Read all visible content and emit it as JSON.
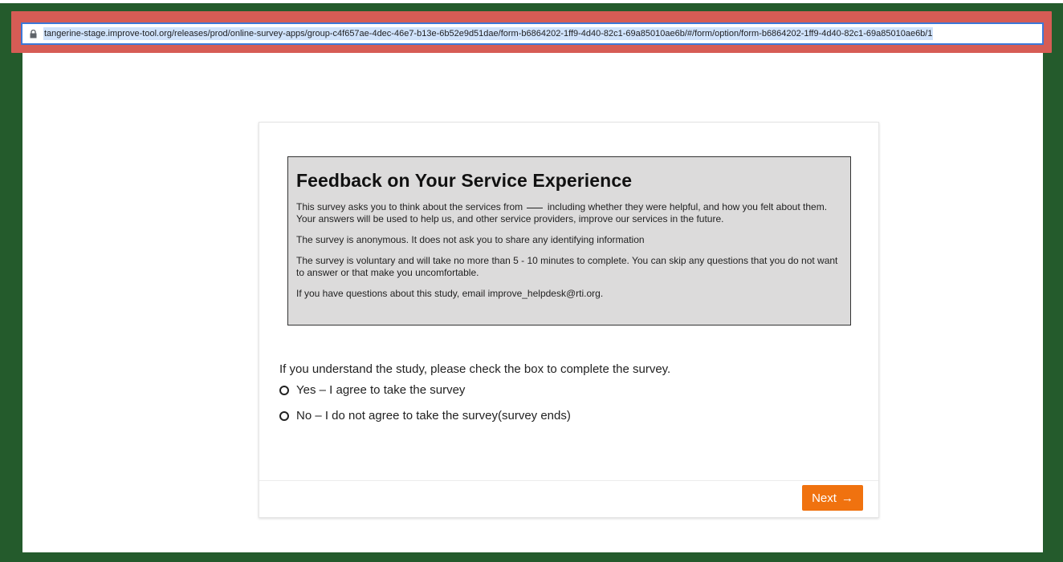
{
  "browser": {
    "url": "tangerine-stage.improve-tool.org/releases/prod/online-survey-apps/group-c4f657ae-4dec-46e7-b13e-6b52e9d51dae/form-b6864202-1ff9-4d40-82c1-69a85010ae6b/#/form/option/form-b6864202-1ff9-4d40-82c1-69a85010ae6b/1",
    "lock_icon": "lock-icon"
  },
  "survey": {
    "title": "Feedback on Your Service Experience",
    "para1_before": "This survey asks you to think about the services from",
    "para1_after": "including whether they were helpful, and how you felt about them. Your answers will be used to help us, and other service providers, improve our services in the future.",
    "para2": "The survey is anonymous. It does not ask you to share any identifying information",
    "para3": "The survey is voluntary and will take no more than 5 - 10 minutes to complete. You can skip any questions that you do not want to answer or that make you uncomfortable.",
    "para4": "If you have questions about this study, email improve_helpdesk@rti.org.",
    "question": "If you understand the study, please check the box to complete the survey.",
    "options": [
      {
        "label": "Yes – I agree to take the survey"
      },
      {
        "label": "No – I do not agree to take the survey(survey ends)"
      }
    ],
    "next_label": "Next",
    "next_icon": "arrow-right-icon"
  },
  "colors": {
    "frame_green": "#245b2c",
    "url_highlight": "#d65c55",
    "info_box_bg": "#dcdbdb",
    "next_button": "#f0720f"
  }
}
